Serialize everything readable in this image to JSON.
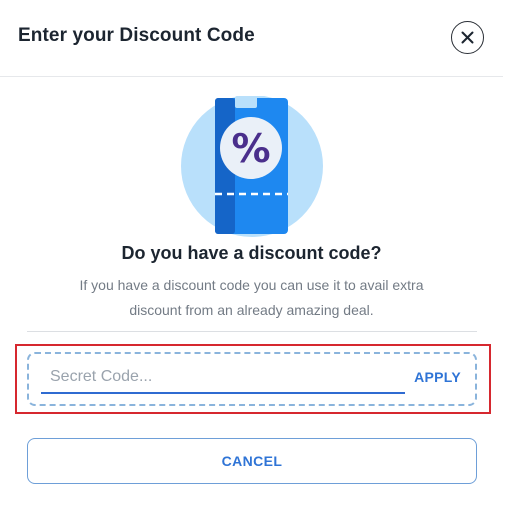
{
  "header": {
    "title": "Enter your Discount Code",
    "close_icon": "close-icon"
  },
  "illustration": {
    "icon": "discount-ticket-icon",
    "symbol": "%",
    "colors": {
      "circle": "#b9e0fb",
      "ticket": "#1e88f0",
      "ticket_dark": "#1565c8",
      "symbol": "#4a2f8c"
    }
  },
  "prompt": {
    "heading": "Do you have a discount code?",
    "description": "If you have a discount code you can use it to avail extra discount from an already amazing deal."
  },
  "code_field": {
    "placeholder": "Secret Code...",
    "value": "",
    "apply_label": "APPLY"
  },
  "actions": {
    "cancel_label": "CANCEL"
  },
  "colors": {
    "accent": "#2f74d6",
    "highlight_border": "#d6282f"
  }
}
